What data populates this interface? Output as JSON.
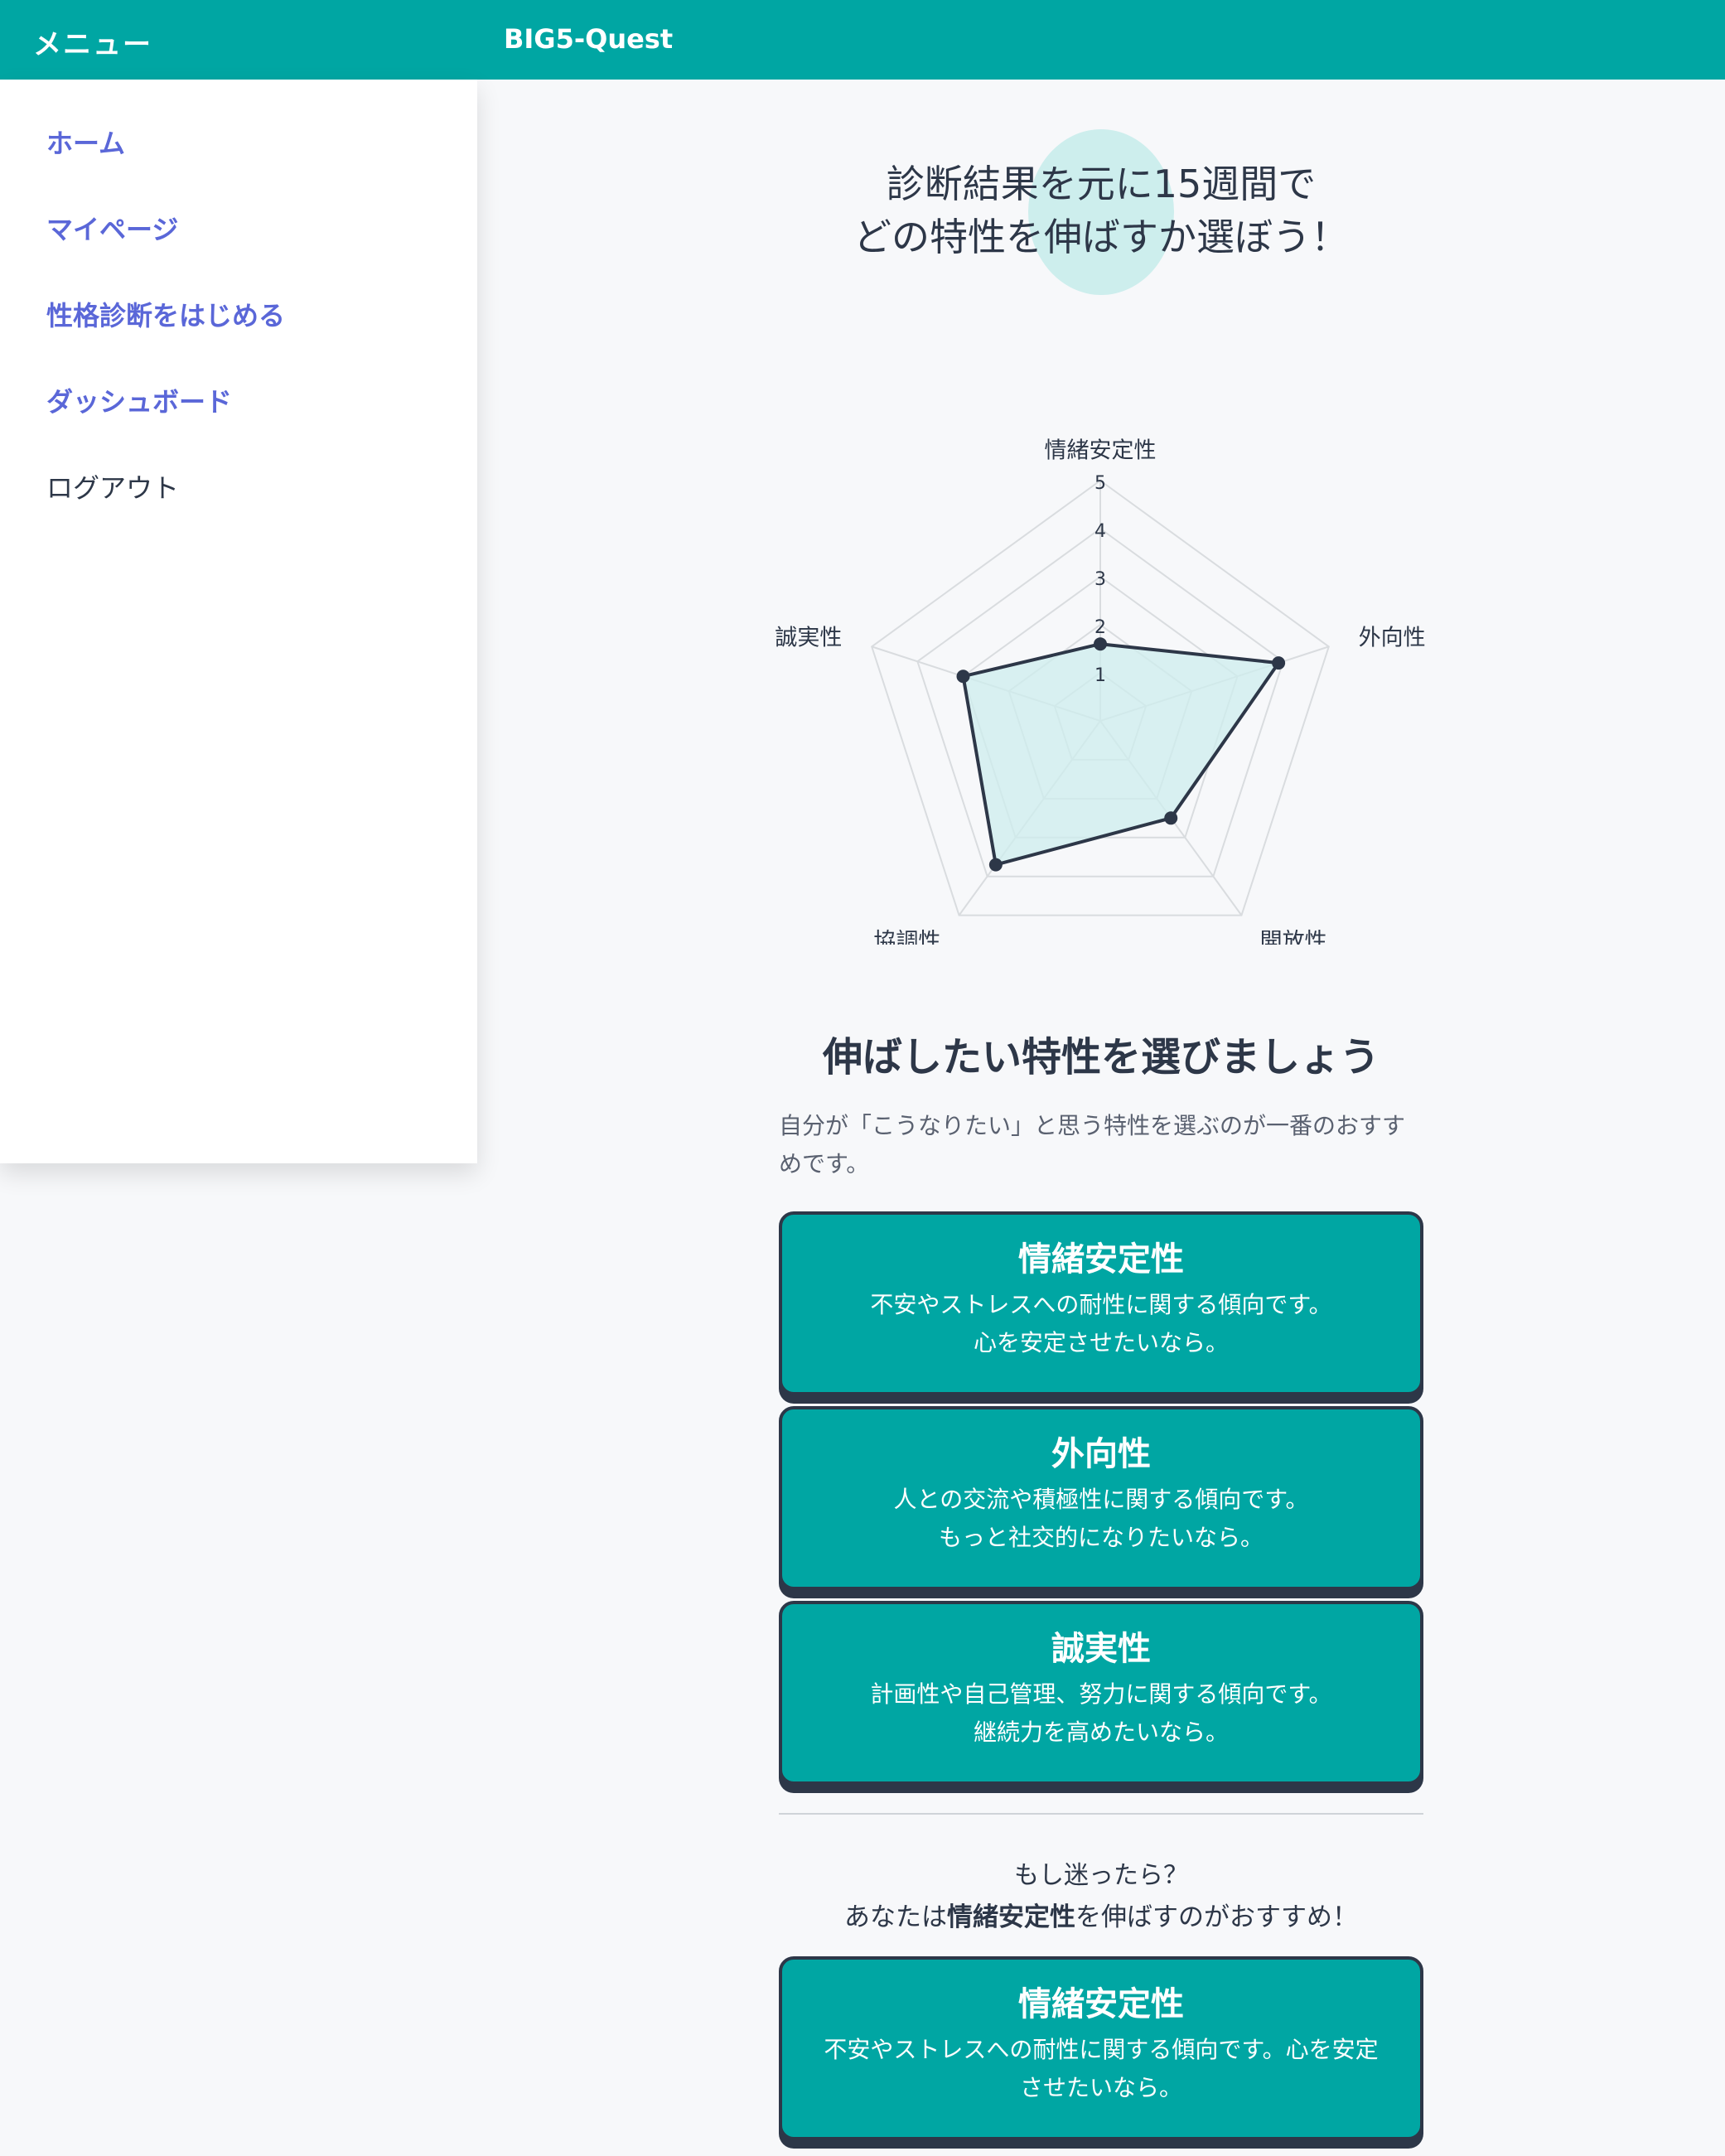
{
  "header": {
    "menu_title": "メニュー",
    "app_title": "BIG5-Quest"
  },
  "sidebar": {
    "items": [
      {
        "label": "ホーム"
      },
      {
        "label": "マイページ"
      },
      {
        "label": "性格診断をはじめる"
      },
      {
        "label": "ダッシュボード"
      },
      {
        "label": "ログアウト"
      }
    ]
  },
  "hero": {
    "line1": "診断結果を元に15週間で",
    "line2": "どの特性を伸ばすか選ぼう！"
  },
  "chart_data": {
    "type": "radar",
    "axes": [
      "情緒安定性",
      "外向性",
      "開放性",
      "協調性",
      "誠実性"
    ],
    "values": [
      1.6,
      3.9,
      2.5,
      3.7,
      3.0
    ],
    "scale": [
      1,
      2,
      3,
      4,
      5
    ],
    "range": [
      0,
      5
    ],
    "colors": {
      "fill": "#cdeeed",
      "line": "#2d3748",
      "grid": "#d9dcdf"
    }
  },
  "selection": {
    "title": "伸ばしたい特性を選びましょう",
    "subtitle": "自分が「こうなりたい」と思う特性を選ぶのが一番のおすすめです。",
    "cards": [
      {
        "title": "情緒安定性",
        "line1": "不安やストレスへの耐性に関する傾向です。",
        "line2": "心を安定させたいなら。"
      },
      {
        "title": "外向性",
        "line1": "人との交流や積極性に関する傾向です。",
        "line2": "もっと社交的になりたいなら。"
      },
      {
        "title": "誠実性",
        "line1": "計画性や自己管理、努力に関する傾向です。",
        "line2": "継続力を高めたいなら。"
      }
    ]
  },
  "recommend": {
    "question": "もし迷ったら？",
    "prefix": "あなたは",
    "trait": "情緒安定性",
    "suffix": "を伸ばすのがおすすめ！",
    "card": {
      "title": "情緒安定性",
      "desc": "不安やストレスへの耐性に関する傾向です。心を安定させたいなら。"
    }
  },
  "theme": {
    "accent": "#00a6a3",
    "link": "#5a67d8",
    "dark": "#2d3748"
  }
}
